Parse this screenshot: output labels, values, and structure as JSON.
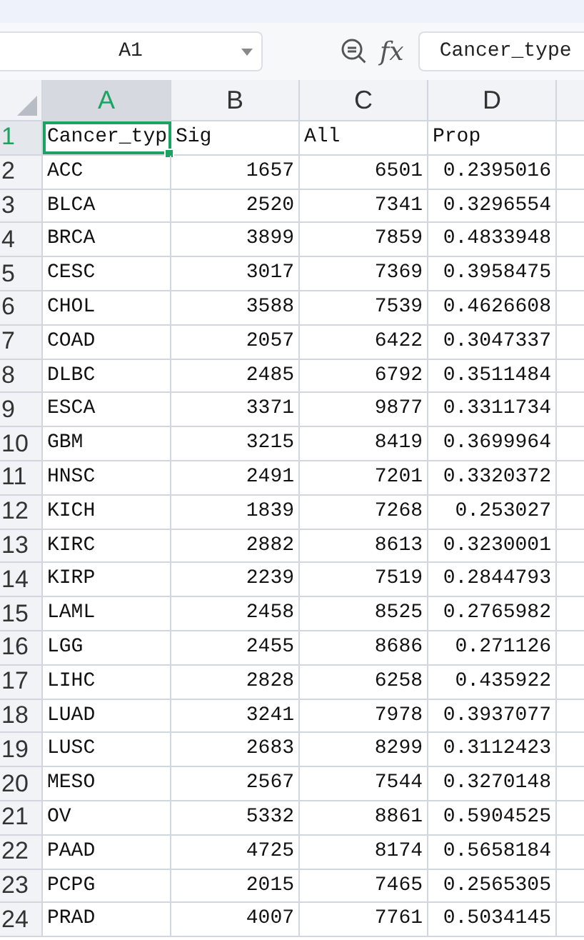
{
  "name_box": {
    "value": "A1"
  },
  "formula_bar": {
    "fx": "fx",
    "value": "Cancer_type"
  },
  "columns": [
    {
      "label": "A",
      "selected": true,
      "kind": "text"
    },
    {
      "label": "B",
      "selected": false,
      "kind": "number"
    },
    {
      "label": "C",
      "selected": false,
      "kind": "number"
    },
    {
      "label": "D",
      "selected": false,
      "kind": "number"
    }
  ],
  "rows": [
    {
      "number": "1",
      "selected": true,
      "kind": "header",
      "cells": [
        "Cancer_typ",
        "Sig",
        "All",
        "Prop"
      ]
    },
    {
      "number": "2",
      "selected": false,
      "kind": "data",
      "cells": [
        "ACC",
        "1657",
        "6501",
        "0.2395016"
      ]
    },
    {
      "number": "3",
      "selected": false,
      "kind": "data",
      "cells": [
        "BLCA",
        "2520",
        "7341",
        "0.3296554"
      ]
    },
    {
      "number": "4",
      "selected": false,
      "kind": "data",
      "cells": [
        "BRCA",
        "3899",
        "7859",
        "0.4833948"
      ]
    },
    {
      "number": "5",
      "selected": false,
      "kind": "data",
      "cells": [
        "CESC",
        "3017",
        "7369",
        "0.3958475"
      ]
    },
    {
      "number": "6",
      "selected": false,
      "kind": "data",
      "cells": [
        "CHOL",
        "3588",
        "7539",
        "0.4626608"
      ]
    },
    {
      "number": "7",
      "selected": false,
      "kind": "data",
      "cells": [
        "COAD",
        "2057",
        "6422",
        "0.3047337"
      ]
    },
    {
      "number": "8",
      "selected": false,
      "kind": "data",
      "cells": [
        "DLBC",
        "2485",
        "6792",
        "0.3511484"
      ]
    },
    {
      "number": "9",
      "selected": false,
      "kind": "data",
      "cells": [
        "ESCA",
        "3371",
        "9877",
        "0.3311734"
      ]
    },
    {
      "number": "10",
      "selected": false,
      "kind": "data",
      "cells": [
        "GBM",
        "3215",
        "8419",
        "0.3699964"
      ]
    },
    {
      "number": "11",
      "selected": false,
      "kind": "data",
      "cells": [
        "HNSC",
        "2491",
        "7201",
        "0.3320372"
      ]
    },
    {
      "number": "12",
      "selected": false,
      "kind": "data",
      "cells": [
        "KICH",
        "1839",
        "7268",
        "0.253027"
      ]
    },
    {
      "number": "13",
      "selected": false,
      "kind": "data",
      "cells": [
        "KIRC",
        "2882",
        "8613",
        "0.3230001"
      ]
    },
    {
      "number": "14",
      "selected": false,
      "kind": "data",
      "cells": [
        "KIRP",
        "2239",
        "7519",
        "0.2844793"
      ]
    },
    {
      "number": "15",
      "selected": false,
      "kind": "data",
      "cells": [
        "LAML",
        "2458",
        "8525",
        "0.2765982"
      ]
    },
    {
      "number": "16",
      "selected": false,
      "kind": "data",
      "cells": [
        "LGG",
        "2455",
        "8686",
        "0.271126"
      ]
    },
    {
      "number": "17",
      "selected": false,
      "kind": "data",
      "cells": [
        "LIHC",
        "2828",
        "6258",
        "0.435922"
      ]
    },
    {
      "number": "18",
      "selected": false,
      "kind": "data",
      "cells": [
        "LUAD",
        "3241",
        "7978",
        "0.3937077"
      ]
    },
    {
      "number": "19",
      "selected": false,
      "kind": "data",
      "cells": [
        "LUSC",
        "2683",
        "8299",
        "0.3112423"
      ]
    },
    {
      "number": "20",
      "selected": false,
      "kind": "data",
      "cells": [
        "MESO",
        "2567",
        "7544",
        "0.3270148"
      ]
    },
    {
      "number": "21",
      "selected": false,
      "kind": "data",
      "cells": [
        "OV",
        "5332",
        "8861",
        "0.5904525"
      ]
    },
    {
      "number": "22",
      "selected": false,
      "kind": "data",
      "cells": [
        "PAAD",
        "4725",
        "8174",
        "0.5658184"
      ]
    },
    {
      "number": "23",
      "selected": false,
      "kind": "data",
      "cells": [
        "PCPG",
        "2015",
        "7465",
        "0.2565305"
      ]
    },
    {
      "number": "24",
      "selected": false,
      "kind": "data",
      "cells": [
        "PRAD",
        "4007",
        "7761",
        "0.5034145"
      ]
    }
  ]
}
